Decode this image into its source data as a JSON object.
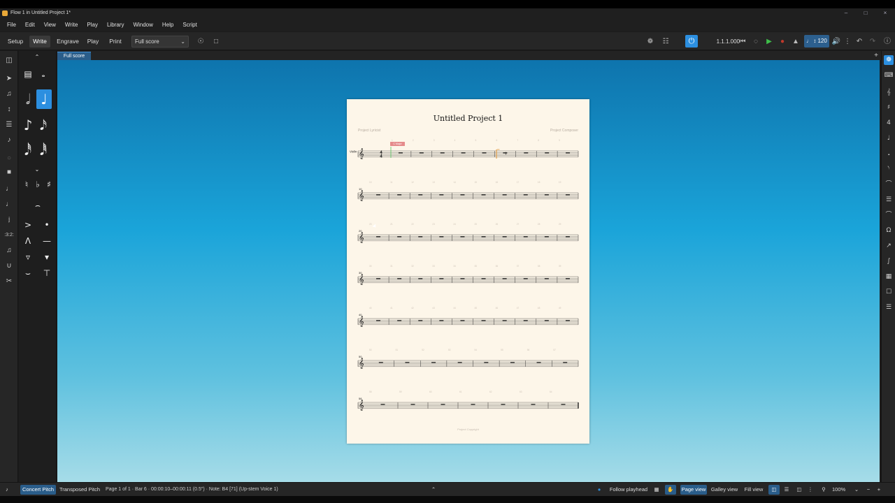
{
  "window": {
    "title": "Flow 1 in Untitled Project 1*",
    "controls": [
      "–",
      "□",
      "×"
    ]
  },
  "menu": [
    "File",
    "Edit",
    "View",
    "Write",
    "Play",
    "Library",
    "Window",
    "Help",
    "Script"
  ],
  "toolbar": {
    "modes": [
      "Setup",
      "Write",
      "Engrave",
      "Play",
      "Print"
    ],
    "active_mode": "Write",
    "layout_select": "Full score",
    "timecode": "1.1.1.000",
    "tempo": "120"
  },
  "tabs": {
    "full_score": "Full score"
  },
  "score": {
    "title": "Untitled Project 1",
    "lyricist": "Project Lyricist",
    "composer": "Project Composer",
    "copyright": "Project Copyright",
    "instrument": "Violin",
    "time_signature": "4/4",
    "key_marker": "C Major",
    "system_start_bars": [
      1,
      10,
      20,
      30,
      40,
      50,
      58
    ],
    "bars_per_system": [
      9,
      10,
      10,
      10,
      10,
      8,
      7
    ],
    "final_bar": 64
  },
  "statusbar": {
    "concert_pitch": "Concert Pitch",
    "transposed_pitch": "Transposed Pitch",
    "info": "Page 1 of 1 · Bar 6 · 00:00:10–00:00:11 (0.5″) · Note: B4 [71] (Up-stem Voice 1)",
    "follow_playhead": "Follow playhead",
    "page_view": "Page view",
    "galley_view": "Galley view",
    "fill_view": "Fill view",
    "zoom": "100%"
  },
  "colors": {
    "accent": "#2c8fe0",
    "page": "#fdf6e9",
    "canvas_top": "#0e74ad",
    "canvas_bottom": "#a6dce8"
  }
}
